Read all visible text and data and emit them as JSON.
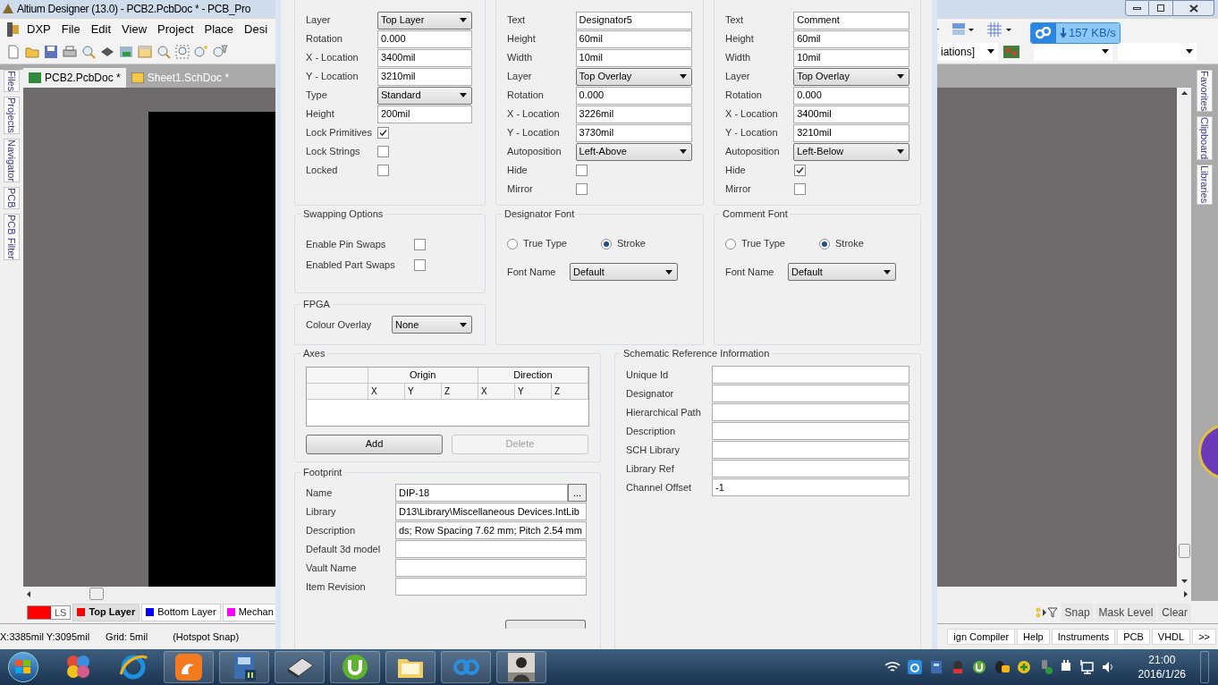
{
  "app": {
    "title": "Altium Designer (13.0) - PCB2.PcbDoc * - PCB_Pro",
    "menu": [
      "DXP",
      "File",
      "Edit",
      "View",
      "Project",
      "Place",
      "Desi"
    ],
    "config_dropdown": "iations]",
    "download_speed": "157 KB/s",
    "doc_tabs": [
      {
        "label": "PCB2.PcbDoc *",
        "selected": true
      },
      {
        "label": "Sheet1.SchDoc *",
        "selected": false
      }
    ],
    "left_panels": [
      "Files",
      "Projects",
      "Navigator",
      "PCB",
      "PCB Filter"
    ],
    "right_panels": [
      "Favorites",
      "Clipboard",
      "Libraries"
    ],
    "current_layer": {
      "label": "LS",
      "color": "#ff0000"
    },
    "layer_tabs": [
      {
        "label": "Top Layer",
        "color": "#ff0000",
        "selected": true
      },
      {
        "label": "Bottom Layer",
        "color": "#0000ff",
        "selected": false
      },
      {
        "label": "Mechan",
        "color": "#ff00ff",
        "selected": false
      }
    ],
    "layer_buttons": [
      "Snap",
      "Mask Level",
      "Clear"
    ],
    "status": [
      "X:3385mil Y:3095mil",
      "Grid: 5mil",
      "(Hotspot Snap)"
    ],
    "panel_buttons": [
      "ign Compiler",
      "Help",
      "Instruments",
      "PCB",
      "VHDL",
      ">>"
    ],
    "clock": {
      "time": "21:00",
      "date": "2016/1/26"
    }
  },
  "dialog": {
    "component": [
      {
        "label": "Layer",
        "kind": "select",
        "value": "Top Layer"
      },
      {
        "label": "Rotation",
        "kind": "text",
        "value": "0.000"
      },
      {
        "label": "X - Location",
        "kind": "text",
        "value": "3400mil"
      },
      {
        "label": "Y - Location",
        "kind": "text",
        "value": "3210mil"
      },
      {
        "label": "Type",
        "kind": "select",
        "value": "Standard"
      },
      {
        "label": "Height",
        "kind": "text",
        "value": "200mil"
      },
      {
        "label": "Lock Primitives",
        "kind": "checkbox",
        "checked": true
      },
      {
        "label": "Lock Strings",
        "kind": "checkbox",
        "checked": false
      },
      {
        "label": "Locked",
        "kind": "checkbox",
        "checked": false
      }
    ],
    "designator": [
      {
        "label": "Text",
        "kind": "text",
        "value": "Designator5"
      },
      {
        "label": "Height",
        "kind": "text",
        "value": "60mil"
      },
      {
        "label": "Width",
        "kind": "text",
        "value": "10mil"
      },
      {
        "label": "Layer",
        "kind": "select",
        "value": "Top Overlay"
      },
      {
        "label": "Rotation",
        "kind": "text",
        "value": "0.000"
      },
      {
        "label": "X - Location",
        "kind": "text",
        "value": "3226mil"
      },
      {
        "label": "Y - Location",
        "kind": "text",
        "value": "3730mil"
      },
      {
        "label": "Autoposition",
        "kind": "select",
        "value": "Left-Above"
      },
      {
        "label": "Hide",
        "kind": "checkbox",
        "checked": false
      },
      {
        "label": "Mirror",
        "kind": "checkbox",
        "checked": false
      }
    ],
    "comment": [
      {
        "label": "Text",
        "kind": "text",
        "value": "Comment"
      },
      {
        "label": "Height",
        "kind": "text",
        "value": "60mil"
      },
      {
        "label": "Width",
        "kind": "text",
        "value": "10mil"
      },
      {
        "label": "Layer",
        "kind": "select",
        "value": "Top Overlay"
      },
      {
        "label": "Rotation",
        "kind": "text",
        "value": "0.000"
      },
      {
        "label": "X - Location",
        "kind": "text",
        "value": "3400mil"
      },
      {
        "label": "Y - Location",
        "kind": "text",
        "value": "3210mil"
      },
      {
        "label": "Autoposition",
        "kind": "select",
        "value": "Left-Below"
      },
      {
        "label": "Hide",
        "kind": "checkbox",
        "checked": true
      },
      {
        "label": "Mirror",
        "kind": "checkbox",
        "checked": false
      }
    ],
    "swapping": {
      "title": "Swapping Options",
      "rows": [
        {
          "label": "Enable Pin Swaps",
          "checked": false
        },
        {
          "label": "Enabled Part Swaps",
          "checked": false
        }
      ]
    },
    "designator_font": {
      "title": "Designator Font",
      "options": [
        {
          "label": "True Type",
          "selected": false
        },
        {
          "label": "Stroke",
          "selected": true
        }
      ],
      "font_label": "Font Name",
      "font": "Default"
    },
    "comment_font": {
      "title": "Comment Font",
      "options": [
        {
          "label": "True Type",
          "selected": false
        },
        {
          "label": "Stroke",
          "selected": true
        }
      ],
      "font_label": "Font Name",
      "font": "Default"
    },
    "fpga": {
      "title": "FPGA",
      "label": "Colour Overlay",
      "value": "None"
    },
    "axes": {
      "title": "Axes",
      "groups": [
        "Origin",
        "Direction"
      ],
      "columns": [
        "X",
        "Y",
        "Z",
        "X",
        "Y",
        "Z"
      ],
      "buttons": [
        {
          "label": "Add",
          "disabled": false
        },
        {
          "label": "Delete",
          "disabled": true
        }
      ]
    },
    "footprint": {
      "title": "Footprint",
      "rows": [
        {
          "label": "Name",
          "value": "DIP-18",
          "browse": "..."
        },
        {
          "label": "Library",
          "value": "D13\\Library\\Miscellaneous Devices.IntLib"
        },
        {
          "label": "Description",
          "value": "ds; Row Spacing 7.62 mm; Pitch 2.54 mm"
        },
        {
          "label": "Default 3d model"
        },
        {
          "label": "Vault Name"
        },
        {
          "label": "Item Revision"
        }
      ]
    },
    "schematic": {
      "title": "Schematic Reference Information",
      "rows": [
        {
          "label": "Unique Id"
        },
        {
          "label": "Designator"
        },
        {
          "label": "Hierarchical Path"
        },
        {
          "label": "Description"
        },
        {
          "label": "SCH Library"
        },
        {
          "label": "Library Ref"
        },
        {
          "label": "Channel Offset",
          "value": "-1"
        }
      ]
    }
  }
}
